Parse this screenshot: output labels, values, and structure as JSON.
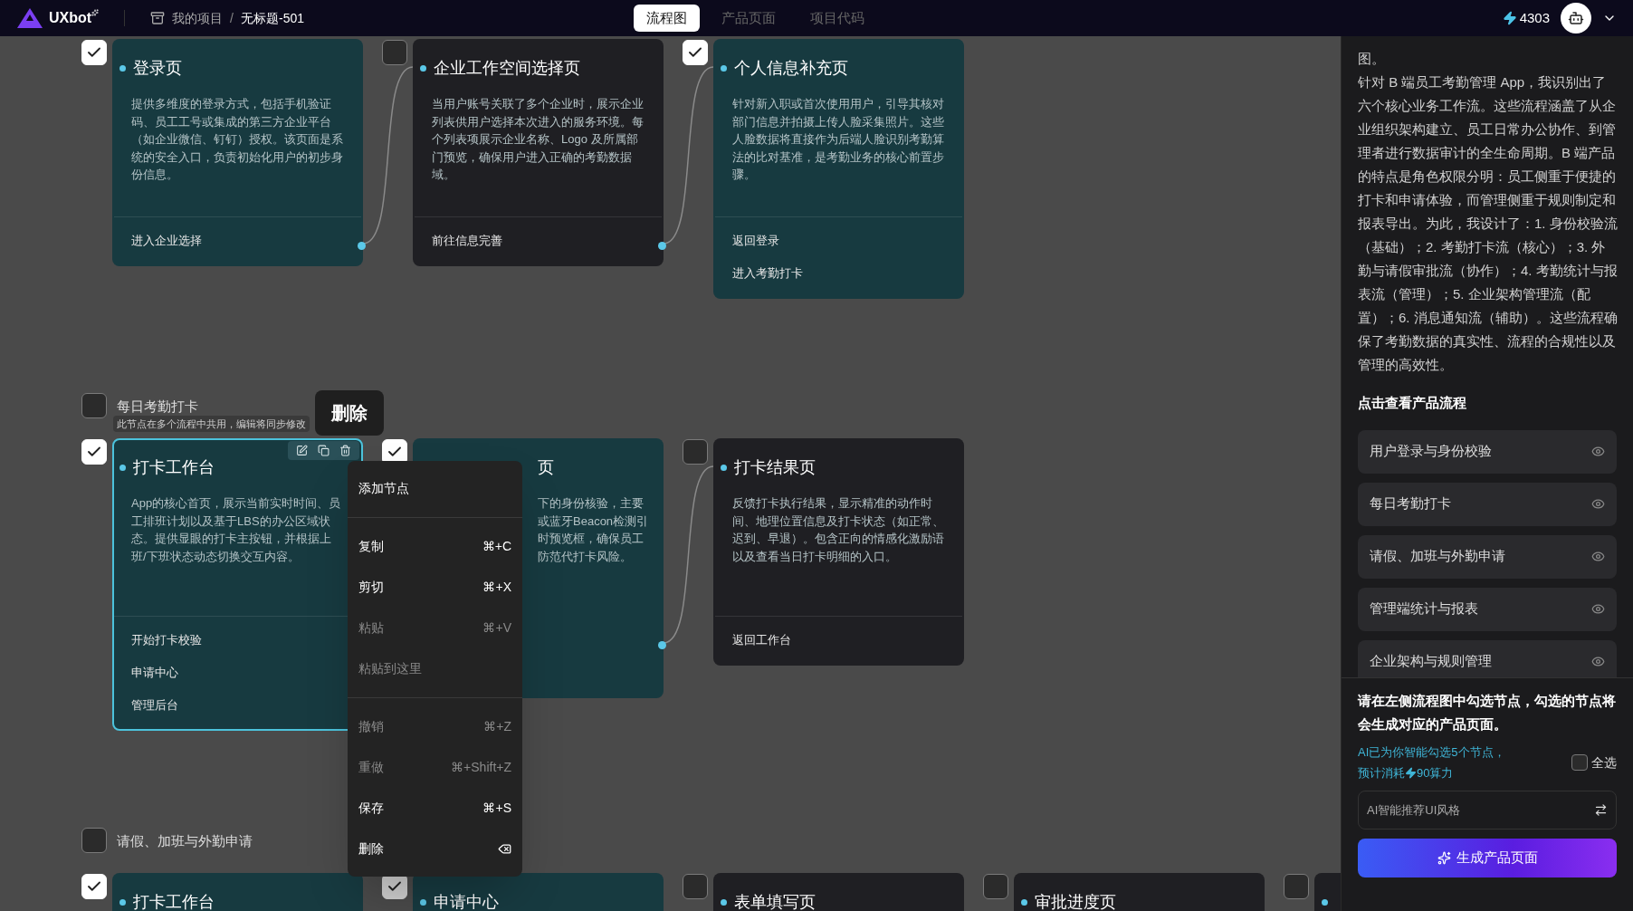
{
  "app": {
    "logo": "UXbot",
    "breadcrumb": [
      "我的项目",
      "无标题-501"
    ],
    "breadcrumb_separator": "/",
    "tabs": [
      {
        "label": "流程图",
        "selected": true
      },
      {
        "label": "产品页面",
        "selected": false
      },
      {
        "label": "项目代码",
        "selected": false
      }
    ],
    "credits": "4303"
  },
  "canvas": {
    "rows": [
      {
        "cards": [
          {
            "kind": "full",
            "checked": true,
            "selected": false,
            "title": "登录页",
            "description": "提供多维度的登录方式，包括手机验证码、员工工号或集成的第三方企业平台（如企业微信、钉钉）授权。该页面是系统的安全入口，负责初始化用户的初步身份信息。",
            "actions": [
              "进入企业选择"
            ],
            "link_next": true
          },
          {
            "kind": "full",
            "checked": false,
            "selected": false,
            "title": "企业工作空间选择页",
            "description": "当用户账号关联了多个企业时，展示企业列表供用户选择本次进入的服务环境。每个列表项展示企业名称、Logo 及所属部门预览，确保用户进入正确的考勤数据域。",
            "actions": [
              "前往信息完善"
            ],
            "link_next": true
          },
          {
            "kind": "full",
            "checked": true,
            "selected": false,
            "title": "个人信息补充页",
            "description": "针对新入职或首次使用用户，引导其核对部门信息并拍摄上传人脸采集照片。这些人脸数据将直接作为后端人脸识别考勤算法的比对基准，是考勤业务的核心前置步骤。",
            "actions": [
              "返回登录",
              "进入考勤打卡"
            ],
            "link_next": false
          }
        ]
      },
      {
        "header": {
          "label": "每日考勤打卡",
          "checked": false,
          "note": "此节点在多个流程中共用，编辑将同步修改"
        },
        "cards": [
          {
            "kind": "full",
            "checked": true,
            "selected": true,
            "title": "打卡工作台",
            "description": "App的核心首页，展示当前实时时间、员工排班计划以及基于LBS的办公区域状态。提供显眼的打卡主按钮，并根据上班/下班状态动态切换交互内容。",
            "actions": [
              "开始打卡校验",
              "申请中心",
              "管理后台"
            ],
            "link_next": false
          },
          {
            "kind": "covered",
            "checked": true,
            "selected": false,
            "title": "页",
            "lines": [
              "下的身份核验，主要",
              "或蓝牙Beacon检测引",
              "时预览框，确保员工",
              "防范代打卡风险。"
            ],
            "link_next": true
          },
          {
            "kind": "full",
            "checked": false,
            "selected": false,
            "title": "打卡结果页",
            "description": "反馈打卡执行结果，显示精准的动作时间、地理位置信息及打卡状态（如正常、迟到、早退）。包含正向的情感化激励语以及查看当日打卡明细的入口。",
            "actions": [
              "返回工作台"
            ],
            "link_next": false
          }
        ]
      },
      {
        "header": {
          "label": "请假、加班与外勤申请",
          "checked": false
        },
        "cards": [
          {
            "kind": "full",
            "checked": true,
            "selected": false,
            "title": "打卡工作台"
          },
          {
            "kind": "full",
            "checked": true,
            "selected": false,
            "title": "申请中心"
          },
          {
            "kind": "full",
            "checked": false,
            "selected": false,
            "title": "表单填写页"
          },
          {
            "kind": "full",
            "checked": false,
            "selected": false,
            "title": "审批进度页"
          },
          {
            "kind": "full",
            "checked": false,
            "selected": false
          }
        ]
      }
    ],
    "tooltip": "删除",
    "context_menu": [
      {
        "kind": "item",
        "label": "添加节点",
        "disabled": false
      },
      {
        "kind": "divider"
      },
      {
        "kind": "item",
        "label": "复制",
        "shortcut": "⌘+C",
        "disabled": false
      },
      {
        "kind": "item",
        "label": "剪切",
        "shortcut": "⌘+X",
        "disabled": false
      },
      {
        "kind": "item",
        "label": "粘贴",
        "shortcut": "⌘+V",
        "disabled": true
      },
      {
        "kind": "item",
        "label": "粘贴到这里",
        "disabled": true
      },
      {
        "kind": "divider"
      },
      {
        "kind": "item",
        "label": "撤销",
        "shortcut": "⌘+Z",
        "disabled": true
      },
      {
        "kind": "item",
        "label": "重做",
        "shortcut": "⌘+Shift+Z",
        "disabled": true
      },
      {
        "kind": "item",
        "label": "保存",
        "shortcut": "⌘+S",
        "disabled": false
      },
      {
        "kind": "item_with_icon",
        "label": "删除",
        "disabled": false
      }
    ]
  },
  "panel": {
    "paragraphs": [
      "图。",
      "针对 B 端员工考勤管理 App，我识别出了六个核心业务工作流。这些流程涵盖了从企业组织架构建立、员工日常办公协作、到管理者进行数据审计的全生命周期。B 端产品的特点是角色权限分明：员工侧重于便捷的打卡和申请体验，而管理侧重于规则制定和报表导出。为此，我设计了：1. 身份校验流（基础）；2. 考勤打卡流（核心）；3. 外勤与请假审批流（协作）；4. 考勤统计与报表流（管理）；5. 企业架构管理流（配置）；6. 消息通知流（辅助）。这些流程确保了考勤数据的真实性、流程的合规性以及管理的高效性。"
    ],
    "flows_heading": "点击查看产品流程",
    "flows": [
      "用户登录与身份校验",
      "每日考勤打卡",
      "请假、加班与外勤申请",
      "管理端统计与报表",
      "企业架构与规则管理"
    ],
    "instruction": "请在左侧流程图中勾选节点，勾选的节点将会生成对应的产品页面。",
    "ai_note": "AI已为你智能勾选5个节点，",
    "cost_prefix": "预计消耗",
    "cost": "90算力",
    "select_all": {
      "label": "全选",
      "checked": false
    },
    "style_field": {
      "placeholder": "AI智能推荐UI风格"
    },
    "generate_button": "生成产品页面"
  }
}
